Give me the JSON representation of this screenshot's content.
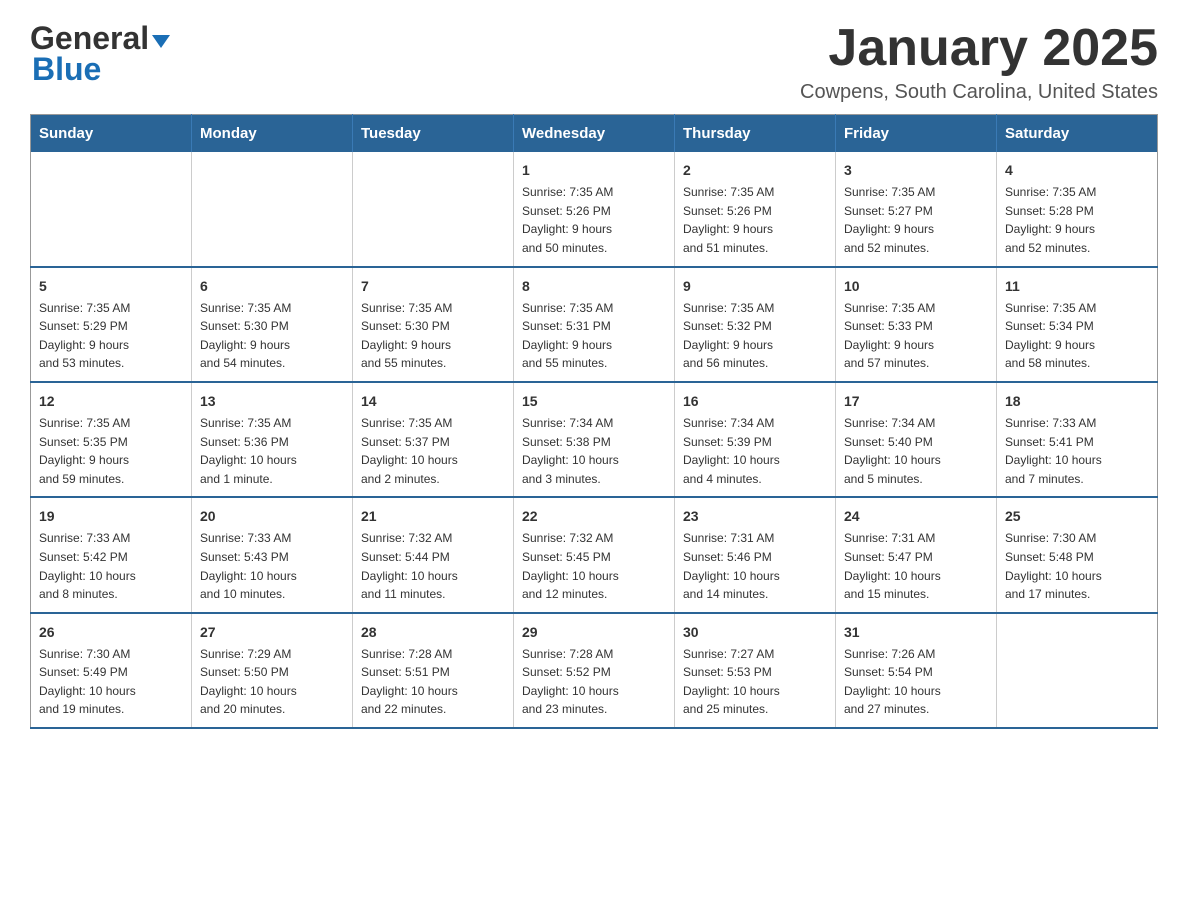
{
  "logo": {
    "text_general": "General",
    "text_blue": "Blue",
    "triangle": "▶"
  },
  "title": {
    "month": "January 2025",
    "location": "Cowpens, South Carolina, United States"
  },
  "days_of_week": [
    "Sunday",
    "Monday",
    "Tuesday",
    "Wednesday",
    "Thursday",
    "Friday",
    "Saturday"
  ],
  "weeks": [
    [
      {
        "day": "",
        "info": ""
      },
      {
        "day": "",
        "info": ""
      },
      {
        "day": "",
        "info": ""
      },
      {
        "day": "1",
        "info": "Sunrise: 7:35 AM\nSunset: 5:26 PM\nDaylight: 9 hours\nand 50 minutes."
      },
      {
        "day": "2",
        "info": "Sunrise: 7:35 AM\nSunset: 5:26 PM\nDaylight: 9 hours\nand 51 minutes."
      },
      {
        "day": "3",
        "info": "Sunrise: 7:35 AM\nSunset: 5:27 PM\nDaylight: 9 hours\nand 52 minutes."
      },
      {
        "day": "4",
        "info": "Sunrise: 7:35 AM\nSunset: 5:28 PM\nDaylight: 9 hours\nand 52 minutes."
      }
    ],
    [
      {
        "day": "5",
        "info": "Sunrise: 7:35 AM\nSunset: 5:29 PM\nDaylight: 9 hours\nand 53 minutes."
      },
      {
        "day": "6",
        "info": "Sunrise: 7:35 AM\nSunset: 5:30 PM\nDaylight: 9 hours\nand 54 minutes."
      },
      {
        "day": "7",
        "info": "Sunrise: 7:35 AM\nSunset: 5:30 PM\nDaylight: 9 hours\nand 55 minutes."
      },
      {
        "day": "8",
        "info": "Sunrise: 7:35 AM\nSunset: 5:31 PM\nDaylight: 9 hours\nand 55 minutes."
      },
      {
        "day": "9",
        "info": "Sunrise: 7:35 AM\nSunset: 5:32 PM\nDaylight: 9 hours\nand 56 minutes."
      },
      {
        "day": "10",
        "info": "Sunrise: 7:35 AM\nSunset: 5:33 PM\nDaylight: 9 hours\nand 57 minutes."
      },
      {
        "day": "11",
        "info": "Sunrise: 7:35 AM\nSunset: 5:34 PM\nDaylight: 9 hours\nand 58 minutes."
      }
    ],
    [
      {
        "day": "12",
        "info": "Sunrise: 7:35 AM\nSunset: 5:35 PM\nDaylight: 9 hours\nand 59 minutes."
      },
      {
        "day": "13",
        "info": "Sunrise: 7:35 AM\nSunset: 5:36 PM\nDaylight: 10 hours\nand 1 minute."
      },
      {
        "day": "14",
        "info": "Sunrise: 7:35 AM\nSunset: 5:37 PM\nDaylight: 10 hours\nand 2 minutes."
      },
      {
        "day": "15",
        "info": "Sunrise: 7:34 AM\nSunset: 5:38 PM\nDaylight: 10 hours\nand 3 minutes."
      },
      {
        "day": "16",
        "info": "Sunrise: 7:34 AM\nSunset: 5:39 PM\nDaylight: 10 hours\nand 4 minutes."
      },
      {
        "day": "17",
        "info": "Sunrise: 7:34 AM\nSunset: 5:40 PM\nDaylight: 10 hours\nand 5 minutes."
      },
      {
        "day": "18",
        "info": "Sunrise: 7:33 AM\nSunset: 5:41 PM\nDaylight: 10 hours\nand 7 minutes."
      }
    ],
    [
      {
        "day": "19",
        "info": "Sunrise: 7:33 AM\nSunset: 5:42 PM\nDaylight: 10 hours\nand 8 minutes."
      },
      {
        "day": "20",
        "info": "Sunrise: 7:33 AM\nSunset: 5:43 PM\nDaylight: 10 hours\nand 10 minutes."
      },
      {
        "day": "21",
        "info": "Sunrise: 7:32 AM\nSunset: 5:44 PM\nDaylight: 10 hours\nand 11 minutes."
      },
      {
        "day": "22",
        "info": "Sunrise: 7:32 AM\nSunset: 5:45 PM\nDaylight: 10 hours\nand 12 minutes."
      },
      {
        "day": "23",
        "info": "Sunrise: 7:31 AM\nSunset: 5:46 PM\nDaylight: 10 hours\nand 14 minutes."
      },
      {
        "day": "24",
        "info": "Sunrise: 7:31 AM\nSunset: 5:47 PM\nDaylight: 10 hours\nand 15 minutes."
      },
      {
        "day": "25",
        "info": "Sunrise: 7:30 AM\nSunset: 5:48 PM\nDaylight: 10 hours\nand 17 minutes."
      }
    ],
    [
      {
        "day": "26",
        "info": "Sunrise: 7:30 AM\nSunset: 5:49 PM\nDaylight: 10 hours\nand 19 minutes."
      },
      {
        "day": "27",
        "info": "Sunrise: 7:29 AM\nSunset: 5:50 PM\nDaylight: 10 hours\nand 20 minutes."
      },
      {
        "day": "28",
        "info": "Sunrise: 7:28 AM\nSunset: 5:51 PM\nDaylight: 10 hours\nand 22 minutes."
      },
      {
        "day": "29",
        "info": "Sunrise: 7:28 AM\nSunset: 5:52 PM\nDaylight: 10 hours\nand 23 minutes."
      },
      {
        "day": "30",
        "info": "Sunrise: 7:27 AM\nSunset: 5:53 PM\nDaylight: 10 hours\nand 25 minutes."
      },
      {
        "day": "31",
        "info": "Sunrise: 7:26 AM\nSunset: 5:54 PM\nDaylight: 10 hours\nand 27 minutes."
      },
      {
        "day": "",
        "info": ""
      }
    ]
  ]
}
